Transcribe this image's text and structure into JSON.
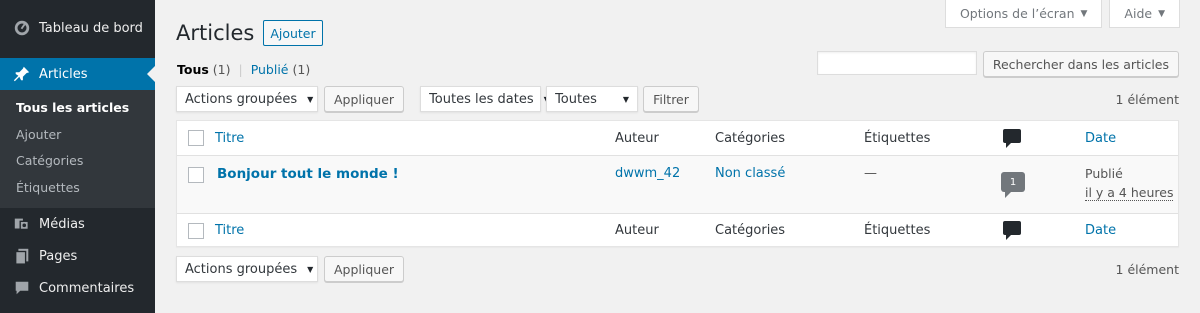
{
  "sidebar": {
    "items": [
      {
        "label": "Tableau de bord",
        "icon": "dashboard-icon"
      },
      {
        "label": "Articles",
        "icon": "pin-icon"
      },
      {
        "label": "Médias",
        "icon": "media-icon"
      },
      {
        "label": "Pages",
        "icon": "pages-icon"
      },
      {
        "label": "Commentaires",
        "icon": "comments-icon"
      }
    ],
    "submenu": [
      "Tous les articles",
      "Ajouter",
      "Catégories",
      "Étiquettes"
    ]
  },
  "screen_tabs": {
    "options": "Options de l’écran",
    "help": "Aide"
  },
  "header": {
    "title": "Articles",
    "add_button": "Ajouter"
  },
  "views": {
    "all_label": "Tous",
    "all_count": "(1)",
    "separator": "|",
    "published_label": "Publié",
    "published_count": "(1)"
  },
  "search": {
    "button": "Rechercher dans les articles",
    "value": ""
  },
  "tablenav_top": {
    "bulk_select": "Actions groupées",
    "apply": "Appliquer",
    "dates_select": "Toutes les dates",
    "cat_select": "Toutes",
    "filter": "Filtrer",
    "items_count": "1 élément"
  },
  "table": {
    "columns": {
      "title": "Titre",
      "author": "Auteur",
      "categories": "Catégories",
      "tags": "Étiquettes",
      "date": "Date"
    },
    "rows": [
      {
        "title": "Bonjour tout le monde !",
        "author": "dwwm_42",
        "categories": "Non classé",
        "tags": "—",
        "comments": "1",
        "date_status": "Publié",
        "date_time": "il y a 4 heures"
      }
    ]
  },
  "tablenav_bottom": {
    "bulk_select": "Actions groupées",
    "apply": "Appliquer",
    "items_count": "1 élément"
  },
  "colors": {
    "sidebar_bg": "#23282d",
    "accent": "#0073aa",
    "page_bg": "#f1f1f1"
  }
}
